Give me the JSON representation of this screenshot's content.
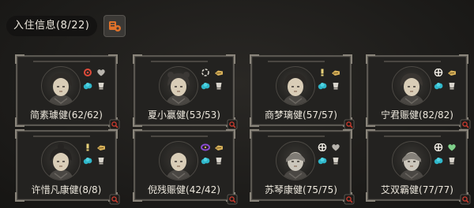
{
  "header": {
    "title": "入住信息",
    "count": "(8/22)",
    "action_icon": "manage-icon"
  },
  "residents": [
    {
      "name": "简素璩健(62/62)",
      "icon_top_left": "red-swirl-icon",
      "icon_top_right": "heart-icon",
      "icon_bottom_left": "blue-cloud-icon",
      "icon_bottom_right": "cup-icon"
    },
    {
      "name": "夏小赢健(53/53)",
      "icon_top_left": "ring-icon",
      "icon_top_right": "golden-hand-icon",
      "icon_bottom_left": "blue-cloud-icon",
      "icon_bottom_right": "cup-icon"
    },
    {
      "name": "商梦璃健(57/57)",
      "icon_top_left": "exclamation-icon",
      "icon_top_right": "golden-hand-icon",
      "icon_bottom_left": "blue-cloud-icon",
      "icon_bottom_right": "cup-icon"
    },
    {
      "name": "宁君赈健(82/82)",
      "icon_top_left": "cross-icon",
      "icon_top_right": "golden-hand-icon",
      "icon_bottom_left": "blue-cloud-icon",
      "icon_bottom_right": "cup-icon"
    },
    {
      "name": "许惜凡康健(8/8)",
      "icon_top_left": "exclamation-icon",
      "icon_top_right": "golden-hand-icon",
      "icon_bottom_left": "blue-cloud-icon",
      "icon_bottom_right": "cup-icon"
    },
    {
      "name": "倪残赈健(42/42)",
      "icon_top_left": "purple-swirl-icon",
      "icon_top_right": "golden-hand-icon",
      "icon_bottom_left": "blue-cloud-icon",
      "icon_bottom_right": "cup-icon"
    },
    {
      "name": "苏琴康健(75/75)",
      "icon_top_left": "cross-icon",
      "icon_top_right": "heart-icon",
      "icon_bottom_left": "blue-cloud-icon",
      "icon_bottom_right": "cup-icon"
    },
    {
      "name": "艾双霸健(77/77)",
      "icon_top_left": "cross-icon",
      "icon_top_right": "green-heart-icon",
      "icon_bottom_left": "blue-cloud-icon",
      "icon_bottom_right": "cup-icon"
    }
  ],
  "colors": {
    "background": "#1e1d1b",
    "card_border": "#5a5751",
    "accent_orange": "#e0722a",
    "icon_blue": "#2fb6c9",
    "icon_gold": "#d9b25a",
    "icon_red": "#e04a3a",
    "location_red": "#c23a2e"
  }
}
